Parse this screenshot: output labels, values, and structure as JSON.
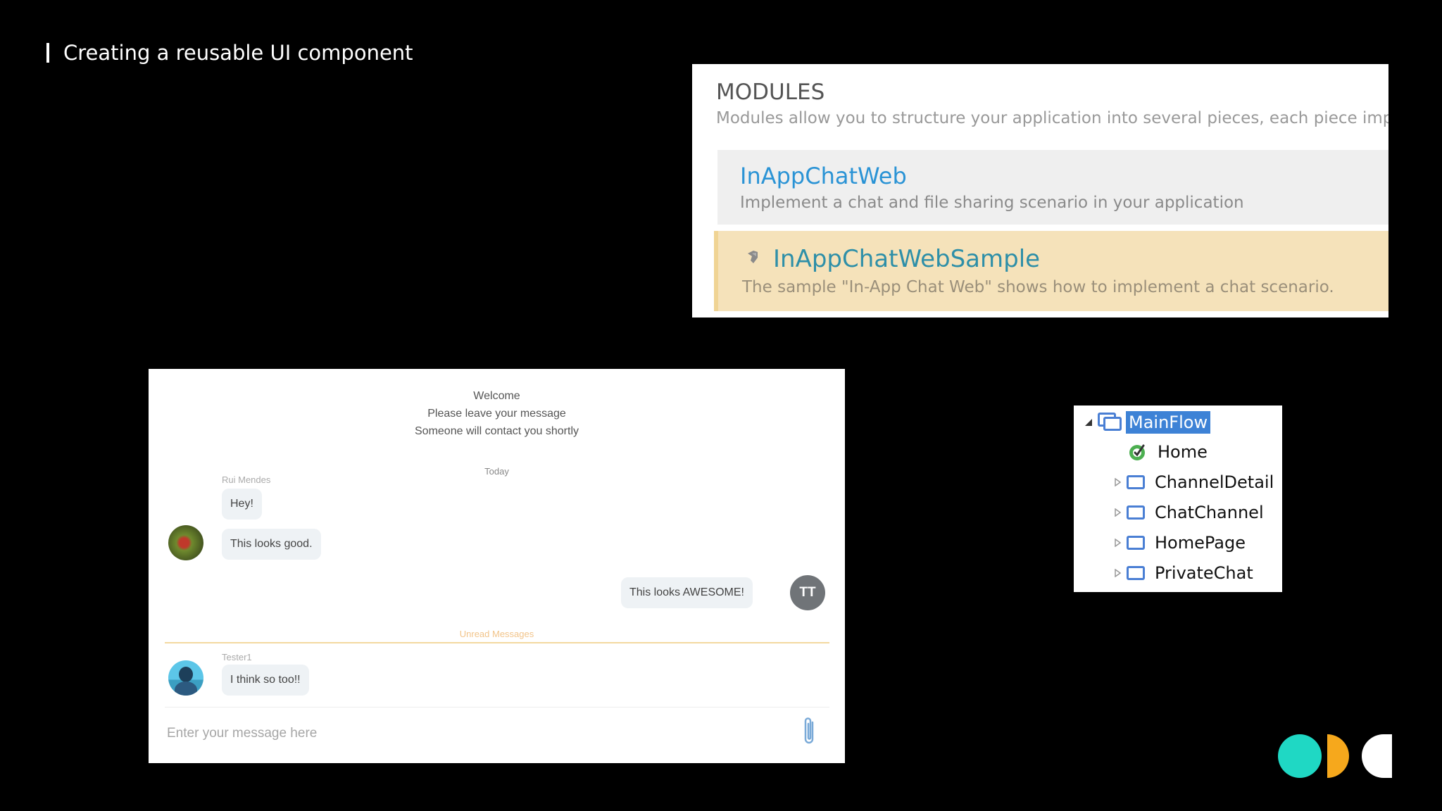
{
  "slide": {
    "title": "Creating a reusable UI component"
  },
  "modules": {
    "heading": "MODULES",
    "description": "Modules allow you to structure your application into several pieces, each piece imple",
    "items": [
      {
        "name": "InAppChatWeb",
        "description": "Implement a chat and file sharing scenario in your application"
      },
      {
        "name": "InAppChatWebSample",
        "description": "The sample \"In-App Chat Web\" shows how to implement a chat scenario."
      }
    ]
  },
  "chat": {
    "welcome": [
      "Welcome",
      "Please leave your message",
      "Someone will contact you shortly"
    ],
    "date_divider": "Today",
    "messages": [
      {
        "sender": "Rui Mendes",
        "text": "Hey!"
      },
      {
        "sender": "",
        "text": "This looks good."
      },
      {
        "sender": "",
        "text": "This looks AWESOME!",
        "avatar_initials": "TT"
      },
      {
        "sender": "Tester1",
        "text": "I think so too!!"
      }
    ],
    "unread_label": "Unread Messages",
    "input_placeholder": "Enter your message here"
  },
  "tree": {
    "root": "MainFlow",
    "children": [
      "Home",
      "ChannelDetail",
      "ChatChannel",
      "HomePage",
      "PrivateChat"
    ]
  },
  "colors": {
    "background": "#000000",
    "module_link": "#2a93d5",
    "module_selected_bg": "#f5e2ba",
    "tree_selected": "#3d82d6",
    "logo_teal": "#1fd8c4",
    "logo_orange": "#f6a81c",
    "logo_white": "#ffffff"
  }
}
